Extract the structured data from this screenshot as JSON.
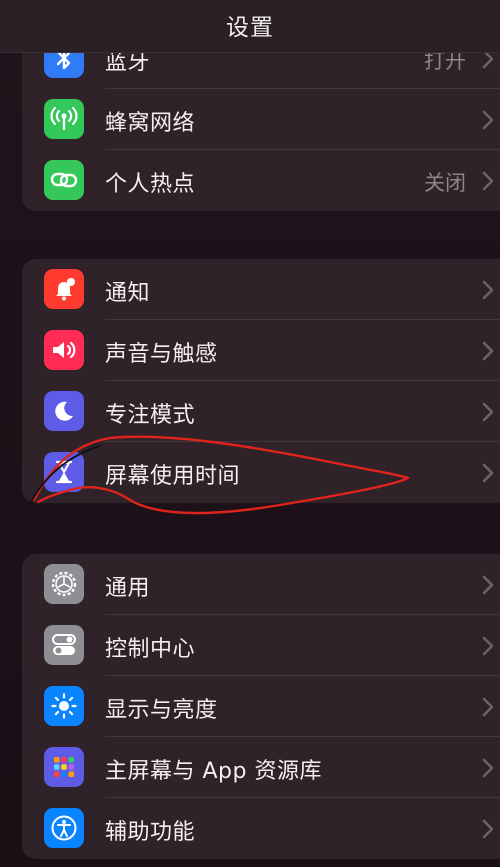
{
  "nav": {
    "title": "设置"
  },
  "groups": [
    {
      "items": [
        {
          "label": "蓝牙",
          "value": "打开",
          "icon": "bluetooth-icon",
          "color": "#2f7cf6"
        },
        {
          "label": "蜂窝网络",
          "value": "",
          "icon": "cellular-antenna-icon",
          "color": "#34c759"
        },
        {
          "label": "个人热点",
          "value": "关闭",
          "icon": "hotspot-chain-icon",
          "color": "#34c759"
        }
      ]
    },
    {
      "items": [
        {
          "label": "通知",
          "icon": "notification-bell-icon",
          "color": "#ff3b30"
        },
        {
          "label": "声音与触感",
          "icon": "speaker-icon",
          "color": "#ff2d55"
        },
        {
          "label": "专注模式",
          "icon": "moon-icon",
          "color": "#5e5ce6"
        },
        {
          "label": "屏幕使用时间",
          "icon": "hourglass-icon",
          "color": "#5e5ce6"
        }
      ]
    },
    {
      "items": [
        {
          "label": "通用",
          "icon": "gear-icon",
          "color": "#8e8e93"
        },
        {
          "label": "控制中心",
          "icon": "toggles-icon",
          "color": "#8e8e93"
        },
        {
          "label": "显示与亮度",
          "icon": "sun-icon",
          "color": "#0a84ff"
        },
        {
          "label": "主屏幕与 App 资源库",
          "icon": "app-grid-icon",
          "color": "#5e5ce6"
        },
        {
          "label": "辅助功能",
          "icon": "accessibility-icon",
          "color": "#0a84ff"
        }
      ]
    }
  ],
  "annotation": {
    "color": "#e0241b",
    "target": "屏幕使用时间"
  }
}
